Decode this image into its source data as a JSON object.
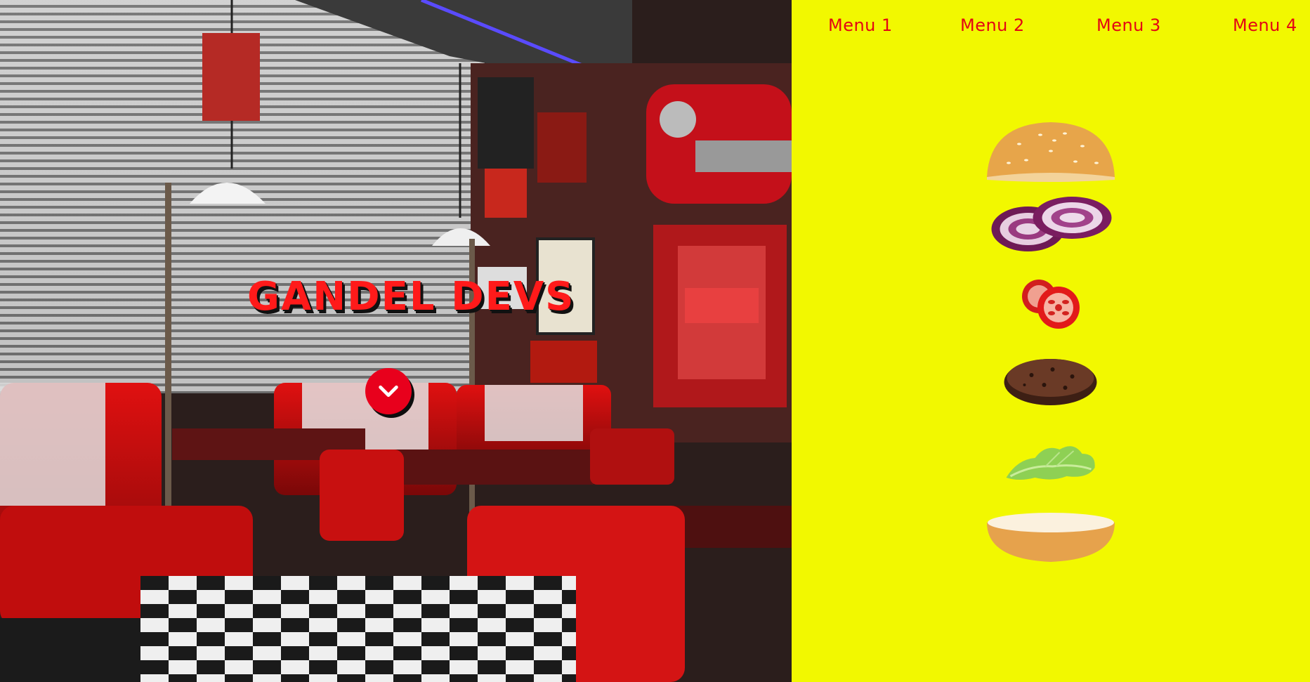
{
  "brand": {
    "title": "GANDEL DEVS"
  },
  "nav": {
    "items": [
      {
        "label": "Menu 1"
      },
      {
        "label": "Menu 2"
      },
      {
        "label": "Menu 3"
      },
      {
        "label": "Menu 4"
      }
    ]
  },
  "colors": {
    "panel_bg": "#f2f800",
    "accent_red": "#e30613",
    "title_shadow": "#111111"
  },
  "icons": {
    "scroll": "chevron-down-icon"
  },
  "burger_layers": [
    "top-bun",
    "onion",
    "tomato",
    "patty",
    "lettuce",
    "bottom-bun"
  ]
}
